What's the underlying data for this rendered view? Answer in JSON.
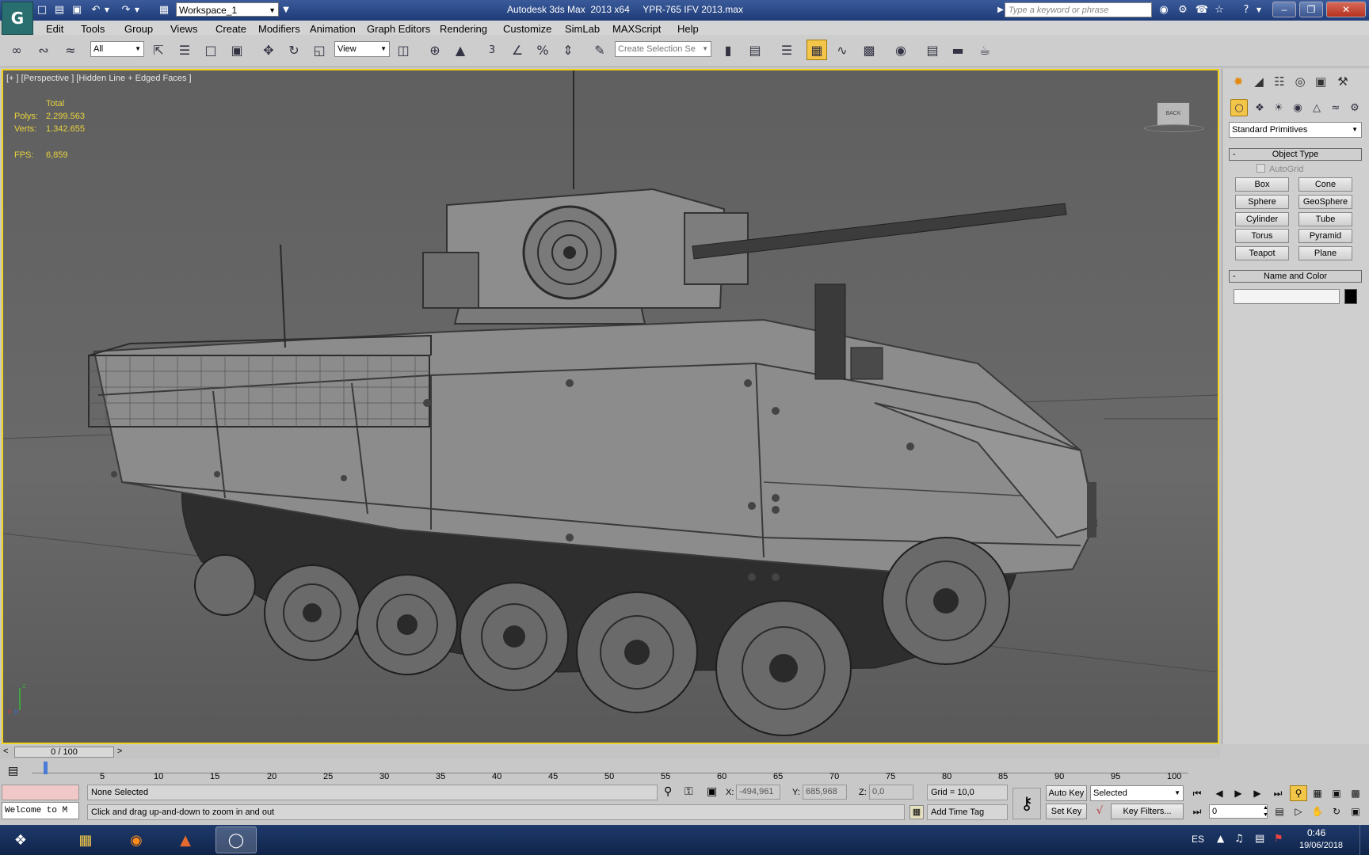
{
  "titlebar": {
    "workspace": "Workspace_1",
    "title": "Autodesk 3ds Max  2013 x64     YPR-765 IFV 2013.max",
    "search_placeholder": "Type a keyword or phrase"
  },
  "menu": [
    "Edit",
    "Tools",
    "Group",
    "Views",
    "Create",
    "Modifiers",
    "Animation",
    "Graph Editors",
    "Rendering",
    "Customize",
    "SimLab",
    "MAXScript",
    "Help"
  ],
  "toolbar": {
    "filter": "All",
    "refcoord": "View",
    "selection_set_placeholder": "Create Selection Se",
    "snap_label": "3"
  },
  "viewport": {
    "label": "[+ ] [Perspective ] [Hidden Line + Edged Faces ]",
    "stats": {
      "header": "Total",
      "polys_label": "Polys:",
      "polys": "2.299.563",
      "verts_label": "Verts:",
      "verts": "1.342.655",
      "fps_label": "FPS:",
      "fps": "6,859"
    },
    "viewcube_label": "BACK",
    "axis": {
      "x": "x",
      "y": "y",
      "z": "z"
    }
  },
  "cmdpanel": {
    "category": "Standard Primitives",
    "object_type_title": "Object Type",
    "autogrid": "AutoGrid",
    "buttons": [
      "Box",
      "Cone",
      "Sphere",
      "GeoSphere",
      "Cylinder",
      "Tube",
      "Torus",
      "Pyramid",
      "Teapot",
      "Plane"
    ],
    "name_color_title": "Name and Color",
    "minus": "-"
  },
  "timeline": {
    "slider": "0 / 100",
    "ticks": [
      "5",
      "10",
      "15",
      "20",
      "25",
      "30",
      "35",
      "40",
      "45",
      "50",
      "55",
      "60",
      "65",
      "70",
      "75",
      "80",
      "85",
      "90",
      "95",
      "100"
    ],
    "left_arrow": "<",
    "right_arrow": ">"
  },
  "status": {
    "maxscript": "Welcome to M",
    "selection": "None Selected",
    "prompt": "Click and drag up-and-down to zoom in and out",
    "x_label": "X:",
    "x": "-494,961",
    "y_label": "Y:",
    "y": "685,968",
    "z_label": "Z:",
    "z": "0,0",
    "grid": "Grid = 10,0",
    "add_time_tag": "Add Time Tag",
    "auto_key": "Auto Key",
    "set_key": "Set Key",
    "selected": "Selected",
    "key_filters": "Key Filters...",
    "frame": "0"
  },
  "taskbar": {
    "lang": "ES",
    "time": "0:46",
    "date": "19/06/2018"
  },
  "colors": {
    "viewport_border": "#f2d21c",
    "stats": "#e8d23c",
    "active_tool": "#f3c64a"
  }
}
